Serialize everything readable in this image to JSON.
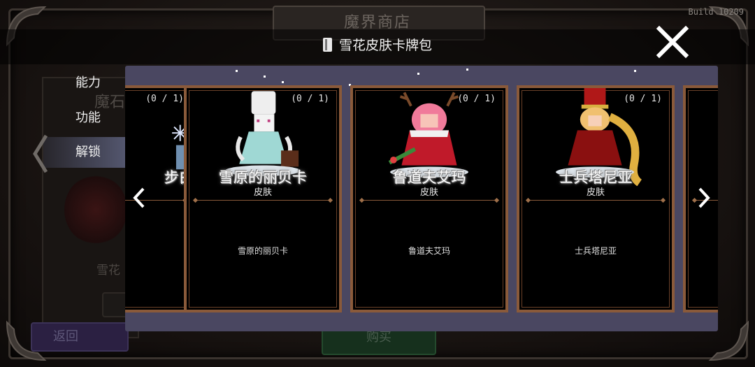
{
  "background": {
    "shop_title": "魔界商店",
    "build_label": "Build 10209",
    "side_label": "魔石",
    "character_label": "雪花",
    "back_button": "返回",
    "buy_button": "购买"
  },
  "dialog": {
    "pack_title": "雪花皮肤卡牌包",
    "close_icon": "close-x-icon"
  },
  "tabs": [
    {
      "label": "能力",
      "active": false
    },
    {
      "label": "功能",
      "active": false
    },
    {
      "label": "解锁",
      "active": true
    }
  ],
  "cards": [
    {
      "name": "",
      "partial_name": "步白",
      "type": "",
      "description": "",
      "count": "(0 / 1)"
    },
    {
      "name": "雪原的丽贝卡",
      "type": "皮肤",
      "description": "雪原的丽贝卡",
      "count": "(0 / 1)"
    },
    {
      "name": "鲁道夫艾玛",
      "type": "皮肤",
      "description": "鲁道夫艾玛",
      "count": "(0 / 1)"
    },
    {
      "name": "士兵塔尼亚",
      "type": "皮肤",
      "description": "士兵塔尼亚",
      "count": "(0 / 1)"
    }
  ],
  "colors": {
    "panel": "#4a4761",
    "card_border": "#8a5a3a",
    "active_tab": "#54576f",
    "back_button": "#2b2042",
    "buy_button": "#16301d"
  }
}
